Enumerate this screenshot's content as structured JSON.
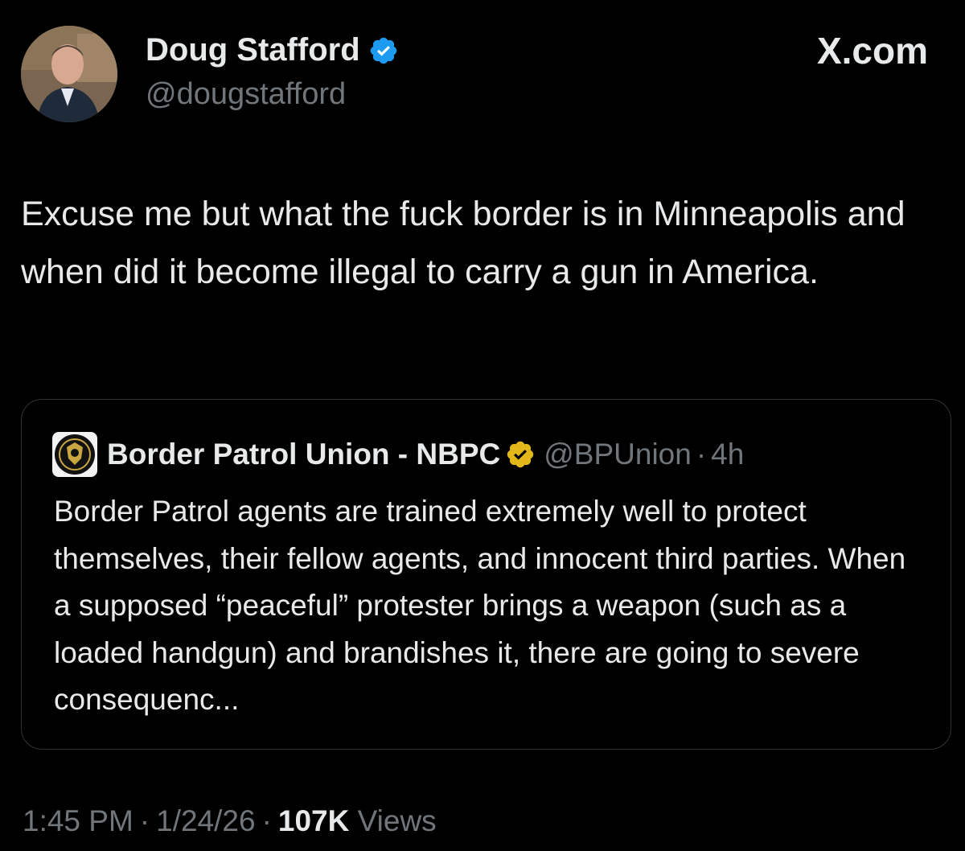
{
  "author": {
    "name": "Doug Stafford",
    "handle": "@dougstafford",
    "verified_color": "#1d9bf0"
  },
  "brand": "X.com",
  "tweet": {
    "text": "Excuse me but what the fuck border is in Minneapolis and when did it become illegal to carry a gun in America."
  },
  "quote": {
    "name": "Border Patrol Union - NBPC",
    "handle": "@BPUnion",
    "separator": "·",
    "time": "4h",
    "verified_color": "#e2b719",
    "text": "Border Patrol agents are trained extremely well to protect themselves, their fellow agents, and innocent third parties. When a supposed “peaceful” protester brings a weapon (such as a loaded handgun) and brandishes it, there are going to severe consequenc..."
  },
  "meta": {
    "time": "1:45 PM",
    "date": "1/24/26",
    "separator": "·",
    "views_count": "107K",
    "views_label": "Views"
  },
  "colors": {
    "background": "#000000",
    "text": "#e7e9ea",
    "secondary": "#71767b",
    "border": "#2f3336"
  }
}
